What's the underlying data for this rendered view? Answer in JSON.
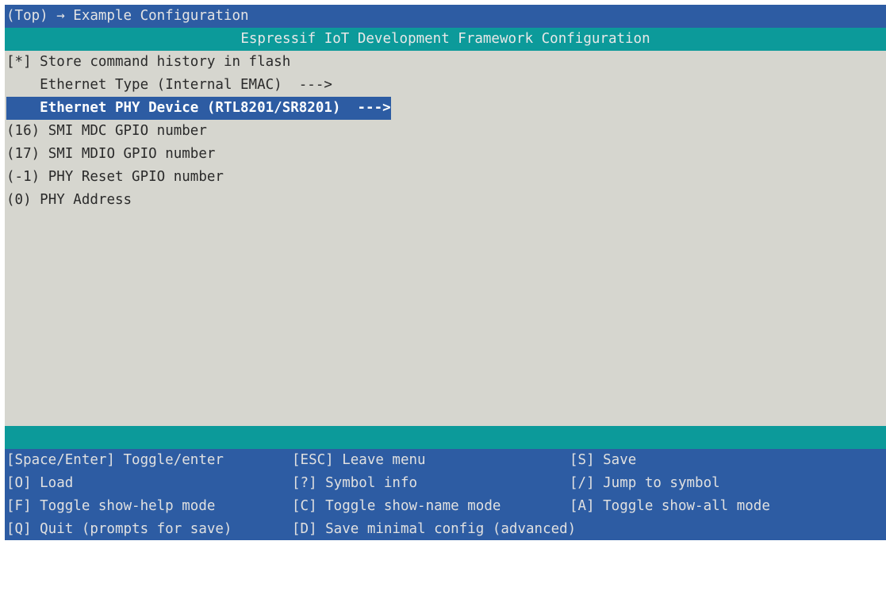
{
  "breadcrumb": "(Top) → Example Configuration",
  "title": "Espressif IoT Development Framework Configuration",
  "menu": {
    "items": [
      {
        "prefix": "[*] ",
        "label": "Store command history in flash"
      },
      {
        "prefix": "    ",
        "label": "Ethernet Type (Internal EMAC)  --->"
      },
      {
        "prefix": "    ",
        "label": "Ethernet PHY Device (RTL8201/SR8201)  --->",
        "selected": true
      },
      {
        "prefix": "(16) ",
        "label": "SMI MDC GPIO number"
      },
      {
        "prefix": "(17) ",
        "label": "SMI MDIO GPIO number"
      },
      {
        "prefix": "(-1) ",
        "label": "PHY Reset GPIO number"
      },
      {
        "prefix": "(0) ",
        "label": "PHY Address"
      }
    ]
  },
  "keys": {
    "rows": [
      [
        "[Space/Enter] Toggle/enter",
        "[ESC] Leave menu",
        "[S] Save"
      ],
      [
        "[O] Load",
        "[?] Symbol info",
        "[/] Jump to symbol"
      ],
      [
        "[F] Toggle show-help mode",
        "[C] Toggle show-name mode",
        "[A] Toggle show-all mode"
      ],
      [
        "[Q] Quit (prompts for save)",
        "[D] Save minimal config (advanced)",
        ""
      ]
    ]
  },
  "colors": {
    "breadcrumb_bg": "#2d5ca3",
    "title_bg": "#0c9a9a",
    "menu_bg": "#d6d6cf",
    "selection_bg": "#2d5ca3"
  }
}
